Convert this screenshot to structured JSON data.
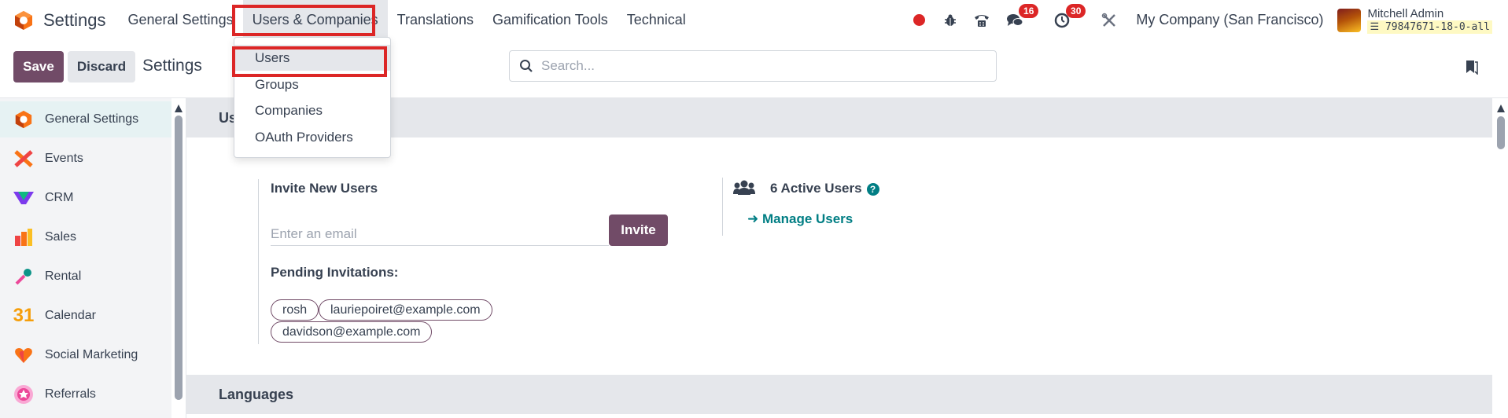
{
  "navbar": {
    "app_name": "Settings",
    "menus": [
      "General Settings",
      "Users & Companies",
      "Translations",
      "Gamification Tools",
      "Technical"
    ],
    "messages_badge": "16",
    "activities_badge": "30",
    "company": "My Company (San Francisco)",
    "user_name": "Mitchell Admin",
    "database": "79847671-18-0-all"
  },
  "dropdown": {
    "items": [
      "Users",
      "Groups",
      "Companies",
      "OAuth Providers"
    ]
  },
  "control": {
    "save_label": "Save",
    "discard_label": "Discard",
    "breadcrumb": "Settings",
    "search_placeholder": "Search..."
  },
  "sidebar": {
    "items": [
      {
        "label": "General Settings",
        "icon": "settings-app-icon"
      },
      {
        "label": "Events",
        "icon": "events-app-icon"
      },
      {
        "label": "CRM",
        "icon": "crm-app-icon"
      },
      {
        "label": "Sales",
        "icon": "sales-app-icon"
      },
      {
        "label": "Rental",
        "icon": "rental-app-icon"
      },
      {
        "label": "Calendar",
        "icon": "calendar-app-icon"
      },
      {
        "label": "Social Marketing",
        "icon": "social-marketing-app-icon"
      },
      {
        "label": "Referrals",
        "icon": "referrals-app-icon"
      }
    ],
    "calendar_number": "31"
  },
  "users_section": {
    "title_visible": "Us",
    "invite_label": "Invite New Users",
    "email_placeholder": "Enter an email",
    "invite_button": "Invite",
    "pending_label": "Pending Invitations:",
    "pending": [
      "rosh",
      "lauriepoiret@example.com",
      "davidson@example.com"
    ],
    "active_users": "6 Active Users",
    "manage_users": "Manage Users"
  },
  "languages_section": {
    "title": "Languages"
  },
  "colors": {
    "primary": "#714b67",
    "link": "#017e84",
    "highlight": "#dc2626"
  }
}
